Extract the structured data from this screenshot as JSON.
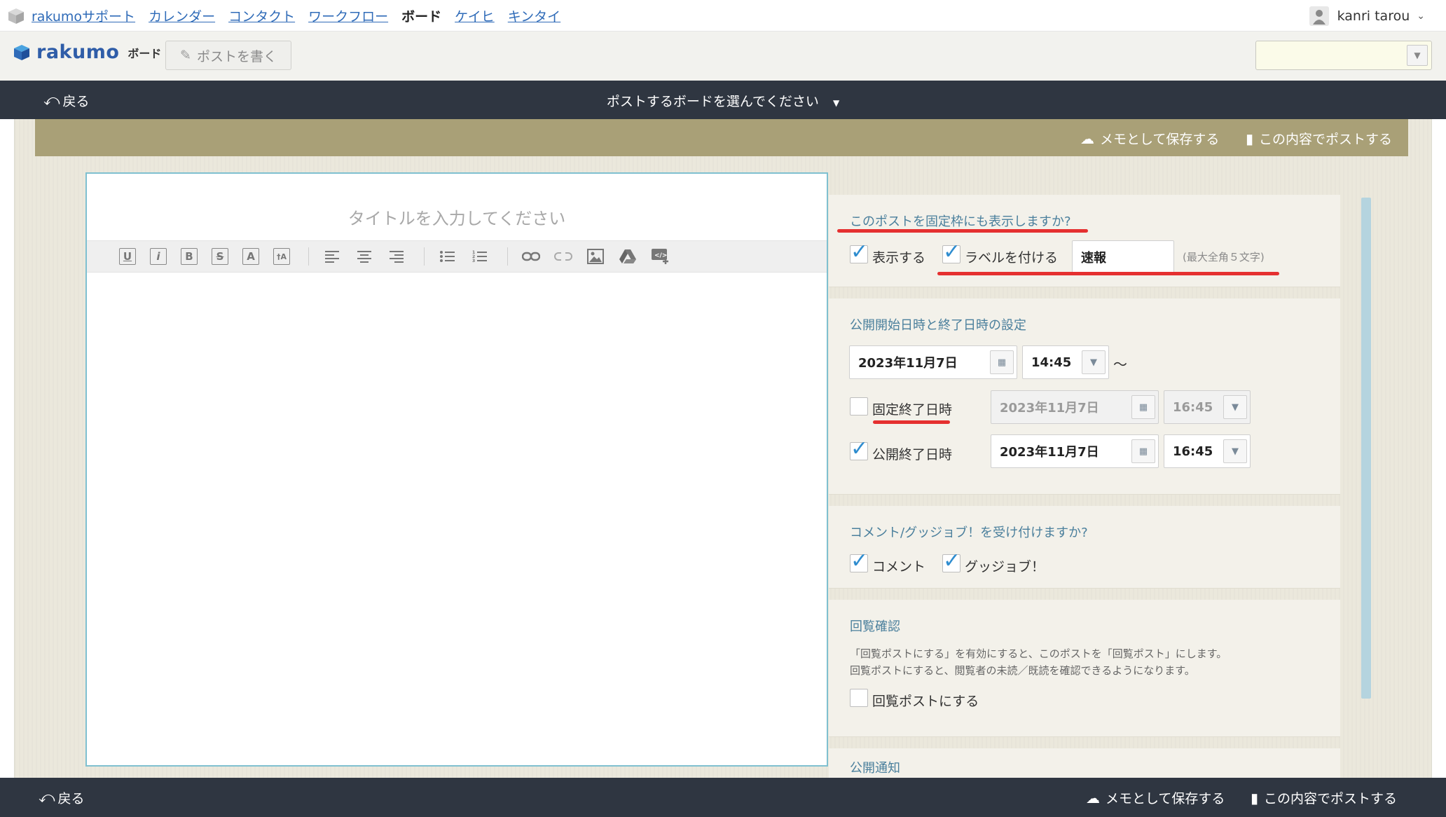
{
  "nav": {
    "links": [
      "rakumoサポート",
      "カレンダー",
      "コンタクト",
      "ワークフロー"
    ],
    "current": "ボード",
    "links_after": [
      "ケイヒ",
      "キンタイ"
    ],
    "user": "kanri tarou"
  },
  "appbar": {
    "brand": "rakumo",
    "product": "ボード",
    "compose_label": "ポストを書く"
  },
  "darkbar": {
    "back_label": "戻る",
    "board_prompt": "ポストするボードを選んでください"
  },
  "actions": {
    "save_memo": "メモとして保存する",
    "post": "この内容でポストする"
  },
  "editor": {
    "title_placeholder": "タイトルを入力してください",
    "toolbar": [
      "underline-icon",
      "italic-icon",
      "bold-icon",
      "strikethrough-icon",
      "font-color-icon",
      "font-size-icon",
      "align-left-icon",
      "align-center-icon",
      "align-right-icon",
      "bullet-list-icon",
      "numbered-list-icon",
      "link-icon",
      "unlink-icon",
      "image-icon",
      "drive-icon",
      "embed-icon"
    ]
  },
  "pin": {
    "question": "このポストを固定枠にも表示しますか?",
    "show_label": "表示する",
    "show_checked": true,
    "label_toggle": "ラベルを付ける",
    "label_checked": true,
    "label_value": "速報",
    "label_hint": "(最大全角５文字)"
  },
  "schedule": {
    "heading": "公開開始日時と終了日時の設定",
    "start_date": "2023年11月7日",
    "start_time": "14:45",
    "tilde": "〜",
    "fixed_end_label": "固定終了日時",
    "fixed_end_checked": false,
    "fixed_end_date": "2023年11月7日",
    "fixed_end_time": "16:45",
    "public_end_label": "公開終了日時",
    "public_end_checked": true,
    "public_end_date": "2023年11月7日",
    "public_end_time": "16:45"
  },
  "feedback": {
    "question": "コメント/グッジョブ！を受け付けますか?",
    "comment_label": "コメント",
    "comment_checked": true,
    "goodjob_label": "グッジョブ！",
    "goodjob_checked": true
  },
  "circulation": {
    "heading": "回覧確認",
    "desc1": "「回覧ポストにする」を有効にすると、このポストを「回覧ポスト」にします。",
    "desc2": "回覧ポストにすると、閲覧者の未読／既読を確認できるようになります。",
    "toggle_label": "回覧ポストにする",
    "toggle_checked": false
  },
  "notify": {
    "heading": "公開通知"
  },
  "colors": {
    "accent": "#4a7f9c",
    "dark": "#2f3641",
    "actionbar": "#a9a077",
    "highlight": "#e53030"
  }
}
